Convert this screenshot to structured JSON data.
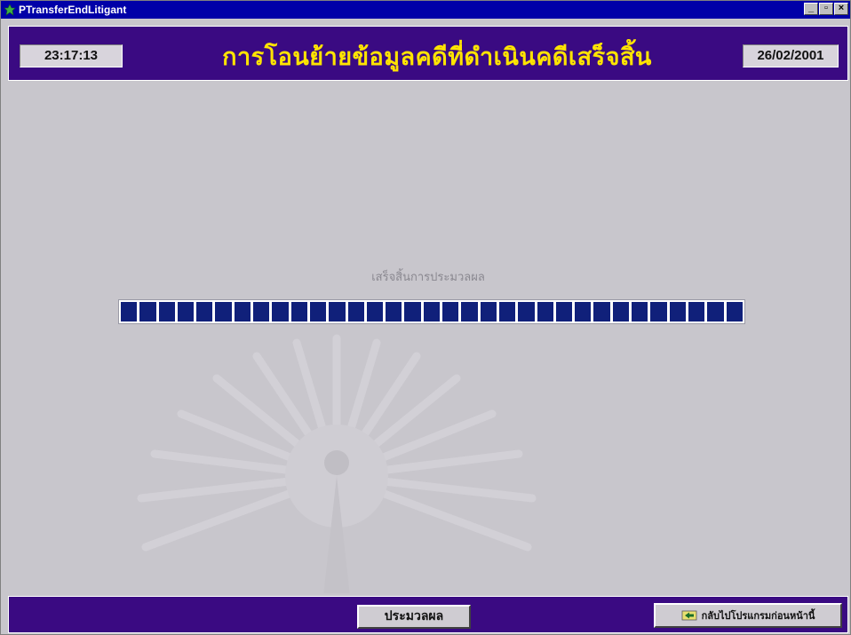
{
  "window": {
    "title": "PTransferEndLitigant",
    "controls": {
      "minimize": "_",
      "maximize": "▫",
      "close": "×"
    }
  },
  "header": {
    "time": "23:17:13",
    "title": "การโอนย้ายข้อมูลคดีที่ดำเนินคดีเสร็จสิ้น",
    "date": "26/02/2001"
  },
  "main": {
    "status_text": "เสร็จสิ้นการประมวลผล",
    "progress": {
      "value": 1.0,
      "segments": 33,
      "color": "#10207a"
    }
  },
  "footer": {
    "process_button": "ประมวลผล",
    "back_button": "กลับไปโปรแกรมก่อนหน้านี้",
    "back_icon": "back-arrow-icon"
  },
  "colors": {
    "title_bar": "#0000a8",
    "header_bg": "#3a0a82",
    "title_text": "#ffe400",
    "surface": "#c8c6cc"
  }
}
